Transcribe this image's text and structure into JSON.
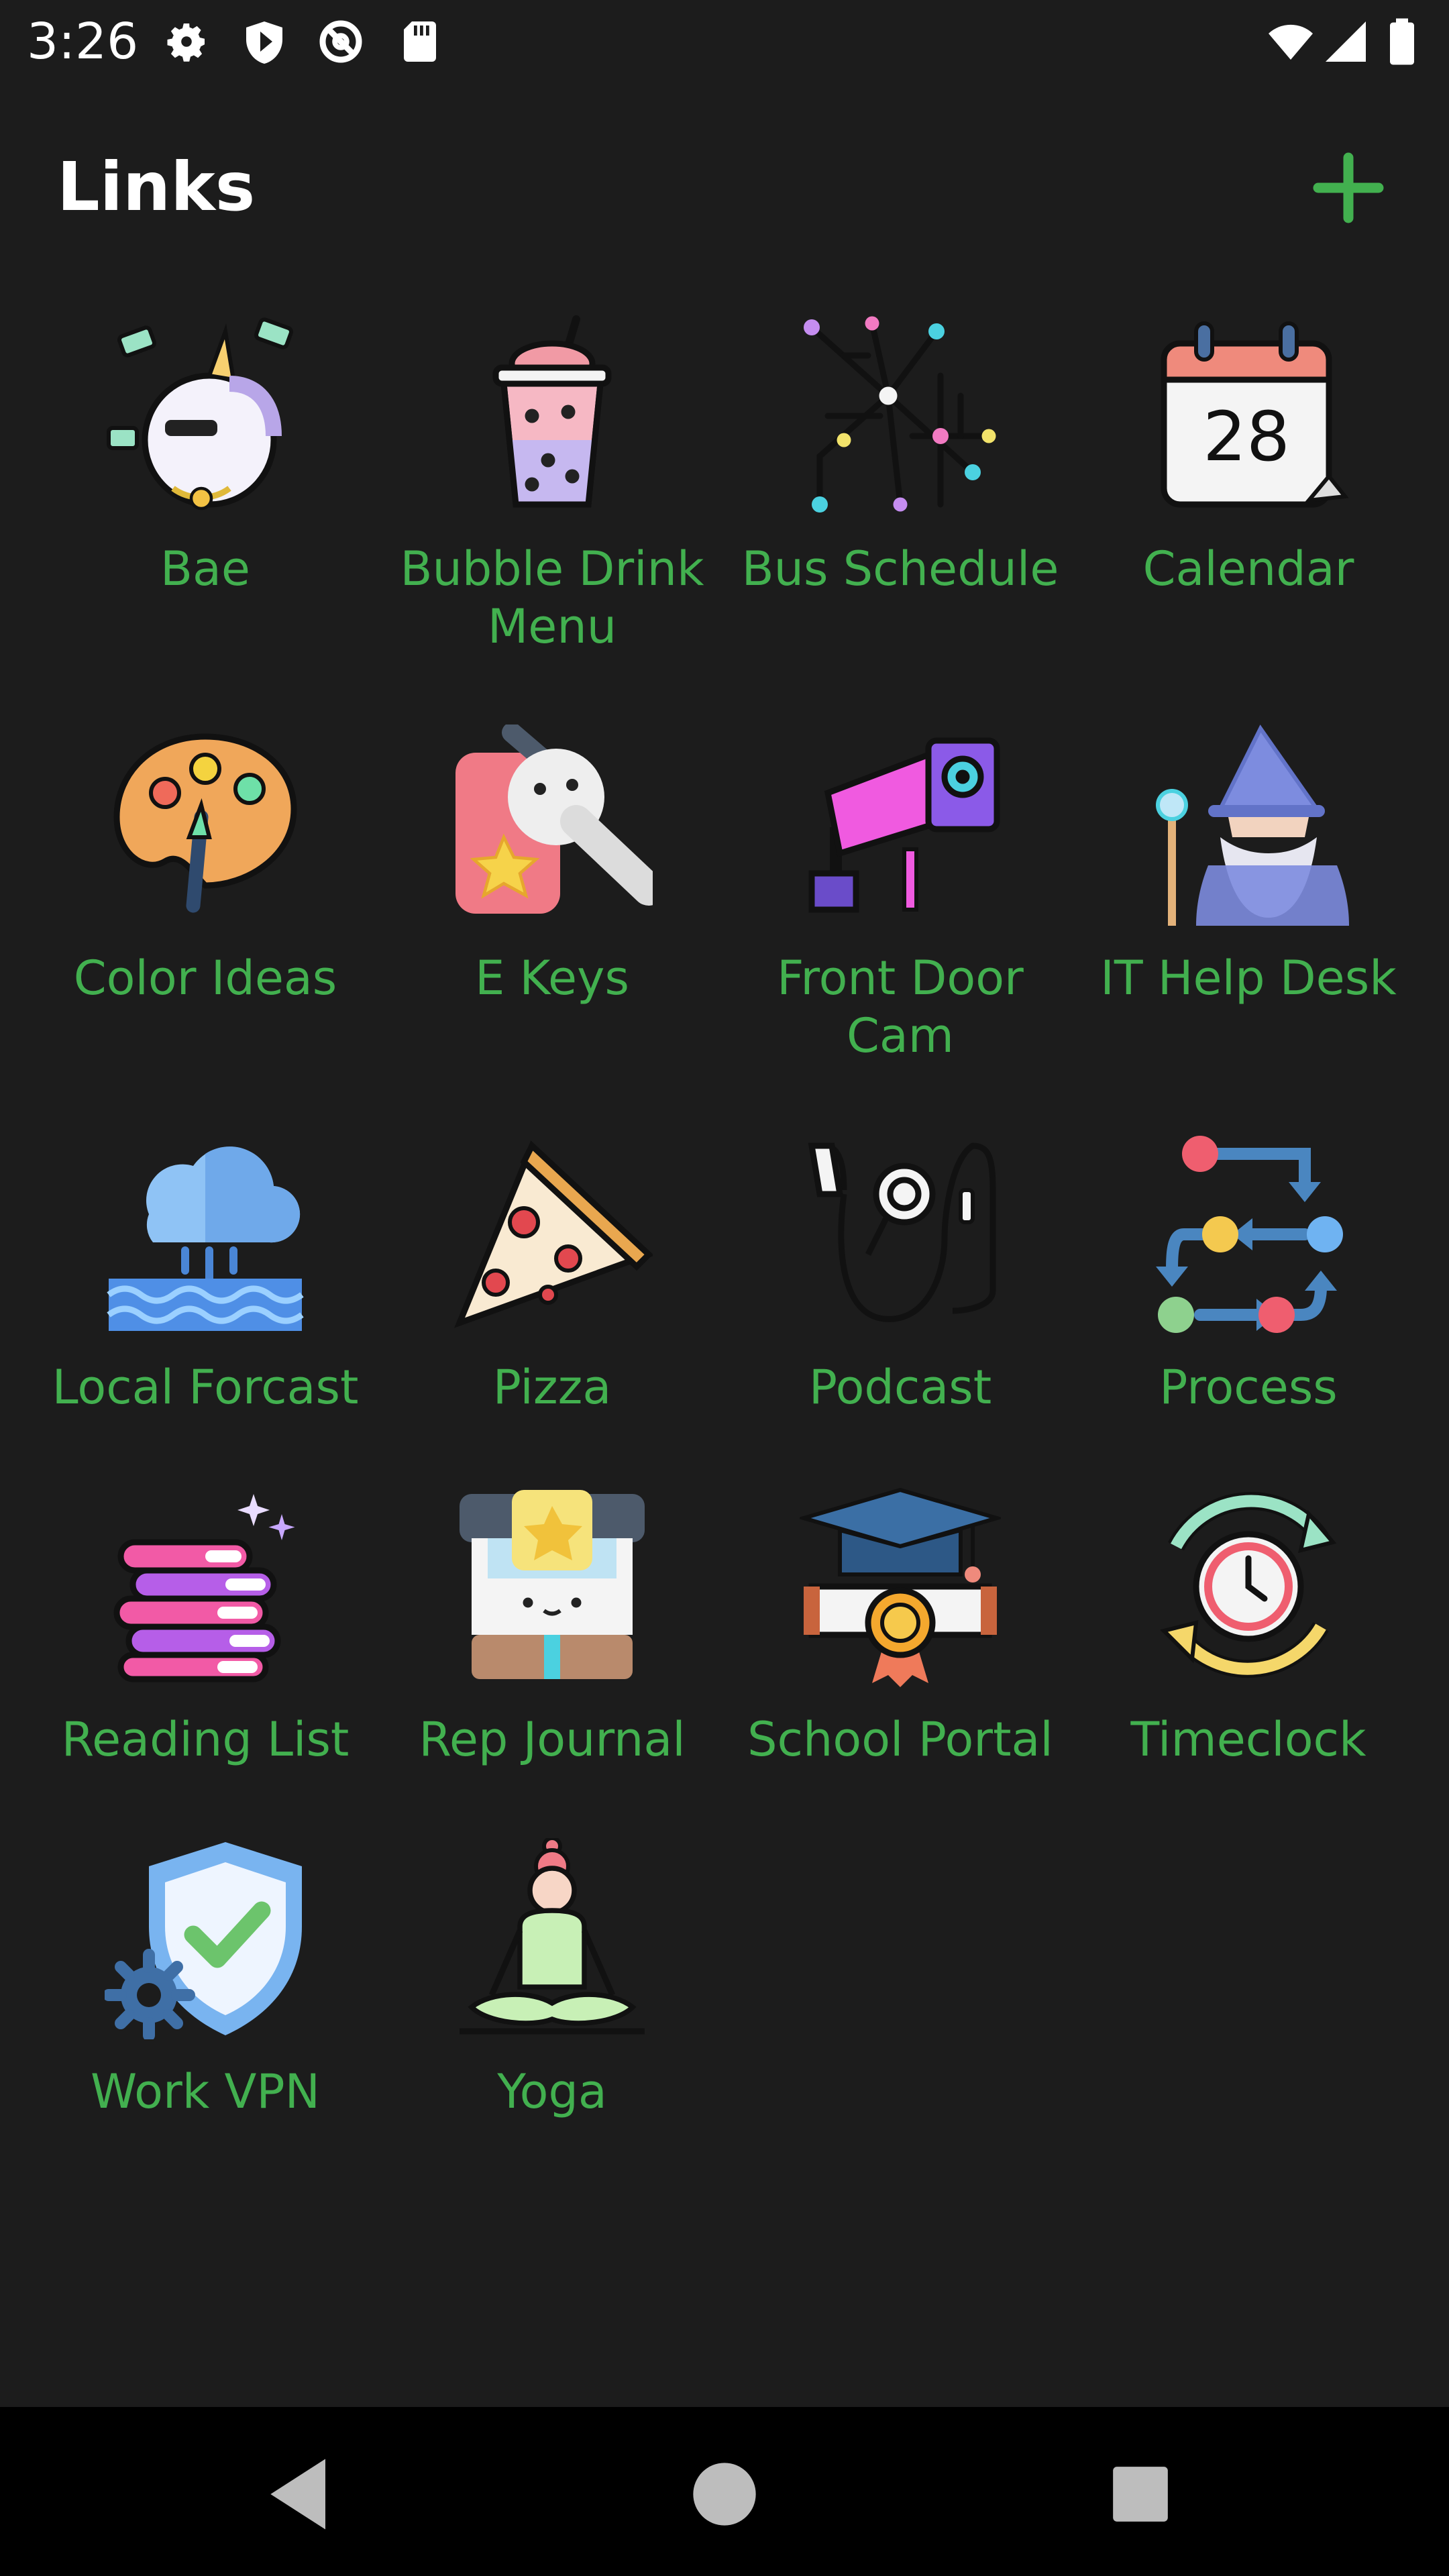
{
  "status_bar": {
    "time": "3:26",
    "icons": [
      "gear-icon",
      "shield-icon",
      "data-saver-icon",
      "sd-card-icon",
      "wifi-icon",
      "signal-icon",
      "battery-icon"
    ]
  },
  "header": {
    "title": "Links",
    "add_icon": "plus-icon"
  },
  "colors": {
    "accent": "#42b04f",
    "background": "#1c1c1c",
    "nav_bar": "#000000"
  },
  "tiles": [
    {
      "label": "Bae",
      "icon": "unicorn-icon"
    },
    {
      "label": "Bubble Drink Menu",
      "icon": "bubble-tea-icon"
    },
    {
      "label": "Bus Schedule",
      "icon": "transit-map-icon"
    },
    {
      "label": "Calendar",
      "icon": "calendar-icon",
      "icon_text": "28"
    },
    {
      "label": "Color Ideas",
      "icon": "paint-palette-icon"
    },
    {
      "label": "E Keys",
      "icon": "key-icon"
    },
    {
      "label": "Front Door Cam",
      "icon": "security-camera-icon"
    },
    {
      "label": "IT Help Desk",
      "icon": "wizard-icon"
    },
    {
      "label": "Local Forcast",
      "icon": "rain-cloud-icon"
    },
    {
      "label": "Pizza",
      "icon": "pizza-slice-icon"
    },
    {
      "label": "Podcast",
      "icon": "earphones-icon"
    },
    {
      "label": "Process",
      "icon": "process-flow-icon"
    },
    {
      "label": "Reading List",
      "icon": "book-stack-icon"
    },
    {
      "label": "Rep Journal",
      "icon": "journal-icon"
    },
    {
      "label": "School Portal",
      "icon": "graduation-cap-icon"
    },
    {
      "label": "Timeclock",
      "icon": "clock-cycle-icon"
    },
    {
      "label": "Work VPN",
      "icon": "shield-check-icon"
    },
    {
      "label": "Yoga",
      "icon": "meditation-icon"
    }
  ],
  "nav": {
    "back": "back-icon",
    "home": "home-icon",
    "recents": "recents-icon"
  }
}
